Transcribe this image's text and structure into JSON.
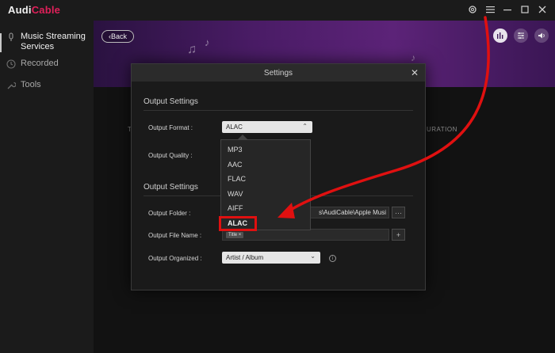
{
  "app": {
    "logo_part1": "Audi",
    "logo_part2": "Cable"
  },
  "sidebar": {
    "items": [
      {
        "label": "Music Streaming Services",
        "icon": "microphone-icon",
        "active": true
      },
      {
        "label": "Recorded",
        "icon": "clock-icon",
        "active": false
      },
      {
        "label": "Tools",
        "icon": "wrench-icon",
        "active": false
      }
    ]
  },
  "banner": {
    "back_label": "Back"
  },
  "behind": {
    "col_left": "T",
    "col_right": "URATION"
  },
  "settings": {
    "title": "Settings",
    "section1": "Output Settings",
    "section2": "Output Settings",
    "output_format_label": "Output Format :",
    "output_format_value": "ALAC",
    "output_quality_label": "Output Quality :",
    "output_folder_label": "Output Folder :",
    "output_folder_value": "s\\AudiCable\\Apple Musi",
    "folder_btn": "···",
    "output_file_name_label": "Output File Name :",
    "file_name_tag": "Title ×",
    "file_name_add": "+",
    "output_organized_label": "Output Organized :",
    "output_organized_value": "Artist / Album",
    "info": "i"
  },
  "format_options": [
    "MP3",
    "AAC",
    "FLAC",
    "WAV",
    "AIFF",
    "ALAC"
  ],
  "colors": {
    "accent": "#e0205a",
    "arrow": "#e01010"
  }
}
